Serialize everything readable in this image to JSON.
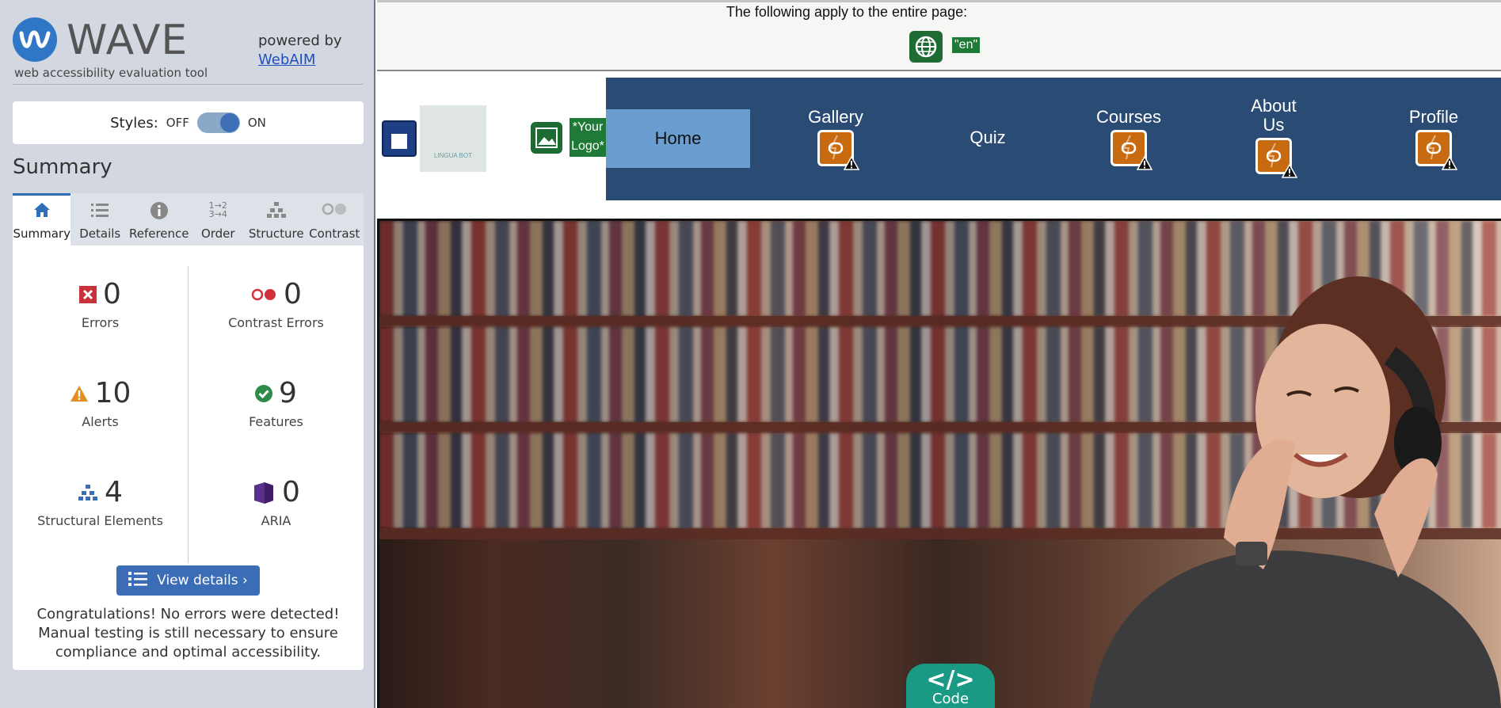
{
  "sidebar": {
    "brand": {
      "name": "WAVE",
      "tagline": "web accessibility evaluation tool",
      "powered_by": "powered by",
      "webaim_link": "WebAIM"
    },
    "styles": {
      "label": "Styles:",
      "off": "OFF",
      "on": "ON",
      "state": "ON"
    },
    "summary_title": "Summary",
    "tabs": [
      {
        "label": "Summary",
        "icon": "home-icon",
        "active": true
      },
      {
        "label": "Details",
        "icon": "list-icon"
      },
      {
        "label": "Reference",
        "icon": "info-icon"
      },
      {
        "label": "Order",
        "icon": "order-icon"
      },
      {
        "label": "Structure",
        "icon": "structure-icon"
      },
      {
        "label": "Contrast",
        "icon": "contrast-icon"
      }
    ],
    "stats": {
      "errors": {
        "count": "0",
        "label": "Errors"
      },
      "contrast_errors": {
        "count": "0",
        "label": "Contrast Errors"
      },
      "alerts": {
        "count": "10",
        "label": "Alerts"
      },
      "features": {
        "count": "9",
        "label": "Features"
      },
      "structural": {
        "count": "4",
        "label": "Structural Elements"
      },
      "aria": {
        "count": "0",
        "label": "ARIA"
      }
    },
    "view_details": "View details ›",
    "congrats": "Congratulations! No errors were detected! Manual testing is still necessary to ensure compliance and optimal accessibility."
  },
  "page": {
    "apply_text": "The following apply to the entire page:",
    "lang_tag": "\"en\"",
    "logo_text": "LINGUA BOT",
    "alt_tag": "*Your Logo*",
    "nav": [
      "Home",
      "Gallery",
      "Quiz",
      "Courses",
      "About Us",
      "Profile"
    ],
    "code_tab": "Code",
    "code_glyph": "</>"
  },
  "colors": {
    "nav_bg": "#2a4c74",
    "nav_active": "#6a9ed0",
    "wave_blue": "#2f76c7",
    "feature_green": "#1f7a37",
    "alert_orange": "#c86a10",
    "code_teal": "#1a9a85"
  }
}
